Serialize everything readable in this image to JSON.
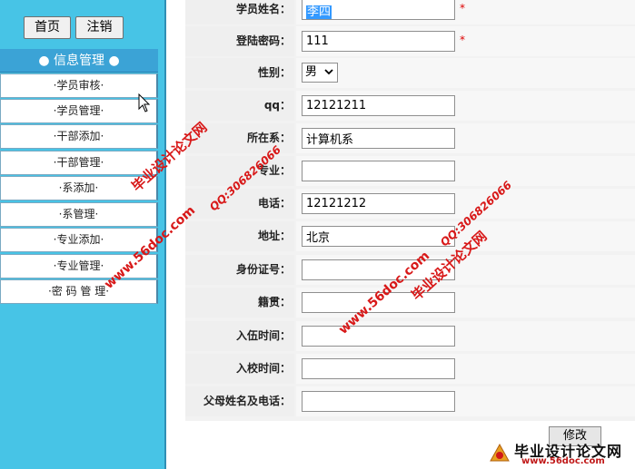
{
  "sidebar": {
    "home_button": "首页",
    "logout_button": "注销",
    "menu_header": "● 信息管理 ●",
    "items": [
      {
        "label": "·学员审核·"
      },
      {
        "label": "·学员管理·"
      },
      {
        "label": "·干部添加·"
      },
      {
        "label": "·干部管理·"
      },
      {
        "label": "·系添加·"
      },
      {
        "label": "·系管理·"
      },
      {
        "label": "·专业添加·"
      },
      {
        "label": "·专业管理·"
      },
      {
        "label": "·密 码 管 理·"
      }
    ]
  },
  "form": {
    "fields": [
      {
        "label": "学员姓名：",
        "value": "李四",
        "required": "*"
      },
      {
        "label": "登陆密码：",
        "value": "111",
        "required": "*"
      },
      {
        "label": "性别：",
        "value": "男"
      },
      {
        "label": "qq：",
        "value": "12121211"
      },
      {
        "label": "所在系：",
        "value": "计算机系"
      },
      {
        "label": "专业：",
        "value": ""
      },
      {
        "label": "电话：",
        "value": "12121212"
      },
      {
        "label": "地址：",
        "value": "北京"
      },
      {
        "label": "身份证号：",
        "value": ""
      },
      {
        "label": "籍贯：",
        "value": ""
      },
      {
        "label": "入伍时间：",
        "value": ""
      },
      {
        "label": "入校时间：",
        "value": ""
      },
      {
        "label": "父母姓名及电话：",
        "value": ""
      }
    ],
    "submit_label": "修改"
  },
  "watermarks": {
    "site_cn": "毕业设计论文网",
    "url": "www.56doc.com",
    "qq": "QQ:306826066",
    "logo_title": "毕业设计论文网",
    "logo_url": "www.56doc.com"
  },
  "colors": {
    "sidebar_bg": "#47c4e6",
    "menu_header_bg": "#3ba3d6",
    "required_mark": "#dd0000",
    "watermark_red": "#d81818"
  }
}
